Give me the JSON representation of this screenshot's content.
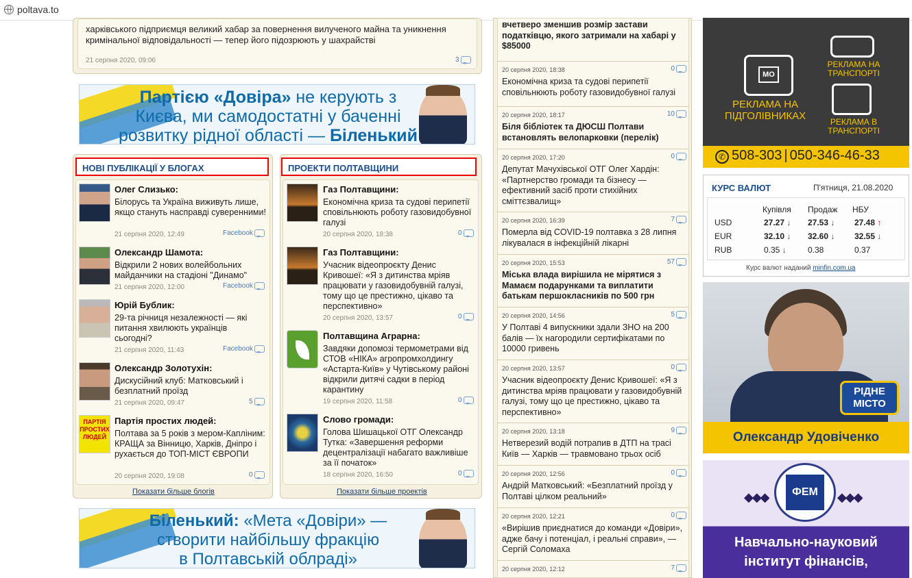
{
  "browser": {
    "url": "poltava.to"
  },
  "top_article": {
    "text": "харківського підприємця великий хабар за повернення вилученого майна та уникнення кримінальної відповідальності — тепер його підозрюють у шахрайстві",
    "date": "21 серпня 2020, 09:06",
    "comments": "3"
  },
  "banner1": {
    "line1a": "Партією «Довіра»",
    "line1b": " не керують з",
    "line2": "Києва, ми самодостатні у баченні",
    "line3a": "розвитку рідної області — ",
    "line3b": "Біленький"
  },
  "banner2": {
    "line1a": "Біленький:",
    "line1b": " «Мета «Довіри» —",
    "line2": "створити найбільшу фракцію",
    "line3": "в Полтавській облраді»"
  },
  "blogs": {
    "title": "НОВІ ПУБЛІКАЦІЇ У БЛОГАХ",
    "more": "Показати більше блогів",
    "items": [
      {
        "author": "Олег Слизько:",
        "text": "Білорусь та Україна виживуть лише, якщо стануть насправді суверенними!",
        "date": "21 серпня 2020, 12:49",
        "source": "Facebook"
      },
      {
        "author": "Олександр Шамота:",
        "text": "Відкрили 2 нових волейбольних майданчики на стадіоні \"Динамо\"",
        "date": "21 серпня 2020, 12:00",
        "source": "Facebook"
      },
      {
        "author": "Юрій Бублик:",
        "text": "29-та річниця незалежності — які питання хвилюють українців сьогодні?",
        "date": "21 серпня 2020, 11:43",
        "source": "Facebook"
      },
      {
        "author": "Олександр Золотухін:",
        "text": "Дискусійний клуб: Матковський і безплатний проїзд",
        "date": "21 серпня 2020, 09:47",
        "count": "5"
      },
      {
        "author": "Партія простих людей:",
        "text": "Полтава за 5 років з мером-Капліним: КРАЩА за Вінницю, Харків, Дніпро і рухається до ТОП-МІСТ ЄВРОПИ",
        "date": "20 серпня 2020, 19:08",
        "count": "0",
        "logo": "ПАРТІЯ ПРОСТИХ ЛЮДЕЙ"
      }
    ]
  },
  "projects": {
    "title": "ПРОЕКТИ ПОЛТАВЩИНИ",
    "more": "Показати більше проектів",
    "items": [
      {
        "author": "Газ Полтавщини:",
        "text": "Економічна криза та судові перипетії сповільнюють роботу газовидобувної галузі",
        "date": "20 серпня 2020, 18:38",
        "count": "0"
      },
      {
        "author": "Газ Полтавщини:",
        "text": "Учасник відеопроєкту Денис Кривошеї: «Я з дитинства мріяв працювати у газовидобувній галузі, тому що це престижно, цікаво та перспективно»",
        "date": "20 серпня 2020, 13:57",
        "count": "0"
      },
      {
        "author": "Полтавщина Аграрна:",
        "text": "Завдяки допомозі термометрами від СТОВ «НІКА» агропромхолдингу «Астарта-Київ» у Чутівському районі відкрили дитячі садки в період карантину",
        "date": "19 серпня 2020, 11:58",
        "count": "0"
      },
      {
        "author": "Слово громади:",
        "text": "Голова Шишацької ОТГ Олександр Тутка: «Завершення реформи децентралізації набагато важливіше за її початок»",
        "date": "18 серпня 2020, 16:50",
        "count": "0"
      }
    ]
  },
  "feed": {
    "top_text": "вчетверо зменшив розмір застави податківцю, якого затримали на хабарі у $85000",
    "items": [
      {
        "date": "20 серпня 2020, 18:38",
        "count": "0",
        "text": "Економічна криза та судові перипетії сповільнюють роботу газовидобувної галузі",
        "bold": false
      },
      {
        "date": "20 серпня 2020, 18:17",
        "count": "10",
        "text": "Біля бібліотек та ДЮСШ Полтави встановлять велопарковки (перелік)",
        "bold": true
      },
      {
        "date": "20 серпня 2020, 17:20",
        "count": "0",
        "text": "Депутат Мачухівської ОТГ Олег Хардін: «Партнерство громади та бізнесу — ефективний засіб проти стихійних сміттєзвалищ»",
        "bold": false
      },
      {
        "date": "20 серпня 2020, 16:39",
        "count": "7",
        "text": "Померла від COVID-19 полтавка з 28 липня лікувалася в інфекційній лікарні",
        "bold": false
      },
      {
        "date": "20 серпня 2020, 15:53",
        "count": "57",
        "text": "Міська влада вирішила не мірятися з Мамаєм подарунками та виплатити батькам першокласників по 500 грн",
        "bold": true
      },
      {
        "date": "20 серпня 2020, 14:56",
        "count": "5",
        "text": "У Полтаві 4 випускники здали ЗНО на 200 балів — їх нагородили сертифікатами по 10000 гривень",
        "bold": false
      },
      {
        "date": "20 серпня 2020, 13:57",
        "count": "0",
        "text": "Учасник відеопроєкту Денис Кривошеї: «Я з дитинства мріяв працювати у газовидобувній галузі, тому що це престижно, цікаво та перспективно»",
        "bold": false
      },
      {
        "date": "20 серпня 2020, 13:18",
        "count": "9",
        "text": "Нетверезий водій потрапив в ДТП на трасі Київ — Харків — травмовано трьох осіб",
        "bold": false
      },
      {
        "date": "20 серпня 2020, 12:56",
        "count": "0",
        "text": "Андрій Матковський: «Безплатний проїзд у Полтаві цілком реальний»",
        "bold": false
      },
      {
        "date": "20 серпня 2020, 12:21",
        "count": "0",
        "text": "«Вирішив приєднатися до команди «Довіри», адже бачу і потенціал, і реальні справи», — Сергій Соломаха",
        "bold": false
      },
      {
        "date": "20 серпня 2020, 12:12",
        "count": "7",
        "text": "",
        "bold": false
      }
    ]
  },
  "ad_transport": {
    "a": "РЕКЛАМА НА ПІДГОЛІВНИКАХ",
    "b": "РЕКЛАМА НА ТРАНСПОРТІ",
    "c": "РЕКЛАМА В ТРАНСПОРТІ",
    "phone1": "508-303",
    "phone2": "050-346-46-33"
  },
  "rates": {
    "title": "КУРС ВАЛЮТ",
    "date": "П'ятниця, 21.08.2020",
    "headers": [
      "Купівля",
      "Продаж",
      "НБУ"
    ],
    "rows": [
      {
        "cur": "USD",
        "buy": "27.27",
        "sell": "27.53",
        "nbu": "27.48",
        "nbu_dir": "up"
      },
      {
        "cur": "EUR",
        "buy": "32.10",
        "sell": "32.60",
        "nbu": "32.55",
        "nbu_dir": "down"
      },
      {
        "cur": "RUB",
        "buy": "0.35",
        "sell": "0.38",
        "nbu": "0.37",
        "nbu_dir": "none"
      }
    ],
    "provided": "Курс валют наданий ",
    "provider": "minfin.com.ua"
  },
  "ad_udovichenko": {
    "name": "Олександр Удовіченко",
    "logo1": "РІДНЕ",
    "logo2": "МІСТО"
  },
  "ad_institute": {
    "logo": "ФЕМ",
    "line1": "Навчально-науковий",
    "line2": "інститут фінансів,"
  },
  "colors": {
    "accent": "#1c4e8a",
    "red": "#e00000",
    "yellow": "#f5c400"
  }
}
